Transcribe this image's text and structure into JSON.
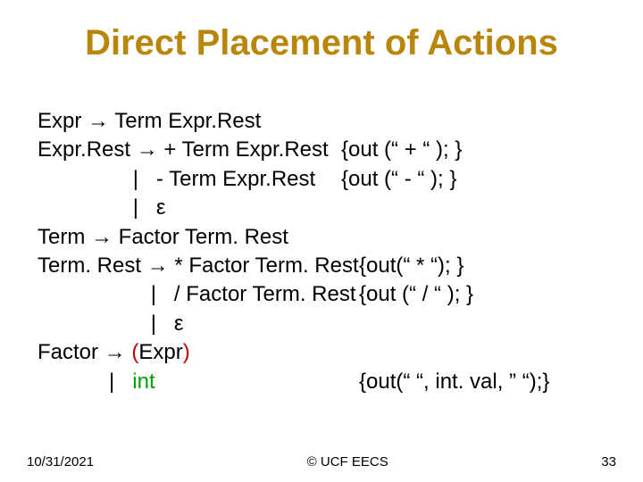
{
  "title": "Direct Placement of Actions",
  "grammar": {
    "l1_lhs": "Expr → Term Expr.Rest",
    "l2_lhs": "Expr.Rest → + Term Expr.Rest",
    "l2_act": "{out (“ + “ ); }",
    "l3_lhs": "                |   - Term Expr.Rest",
    "l3_act": "{out (“ - “ ); }",
    "l4_lhs": "                |   ε",
    "l5_lhs": "Term → Factor Term. Rest",
    "l6_lhs": "Term. Rest → * Factor Term. Rest",
    "l6_act": "{out(“ * “); }",
    "l7_lhs": "                   |   / Factor Term. Rest",
    "l7_act": "{out (“ / “ ); }",
    "l8_lhs": "                   |   ε",
    "l9_pre": "Factor → ",
    "l9_lp": "(",
    "l9_mid": "Expr",
    "l9_rp": ")",
    "l10_lhs": "            |   ",
    "l10_int": "int",
    "l10_act": "{out(“ “, int. val, ” “);}"
  },
  "footer": {
    "date": "10/31/2021",
    "copyright": "© UCF EECS",
    "page": "33"
  }
}
